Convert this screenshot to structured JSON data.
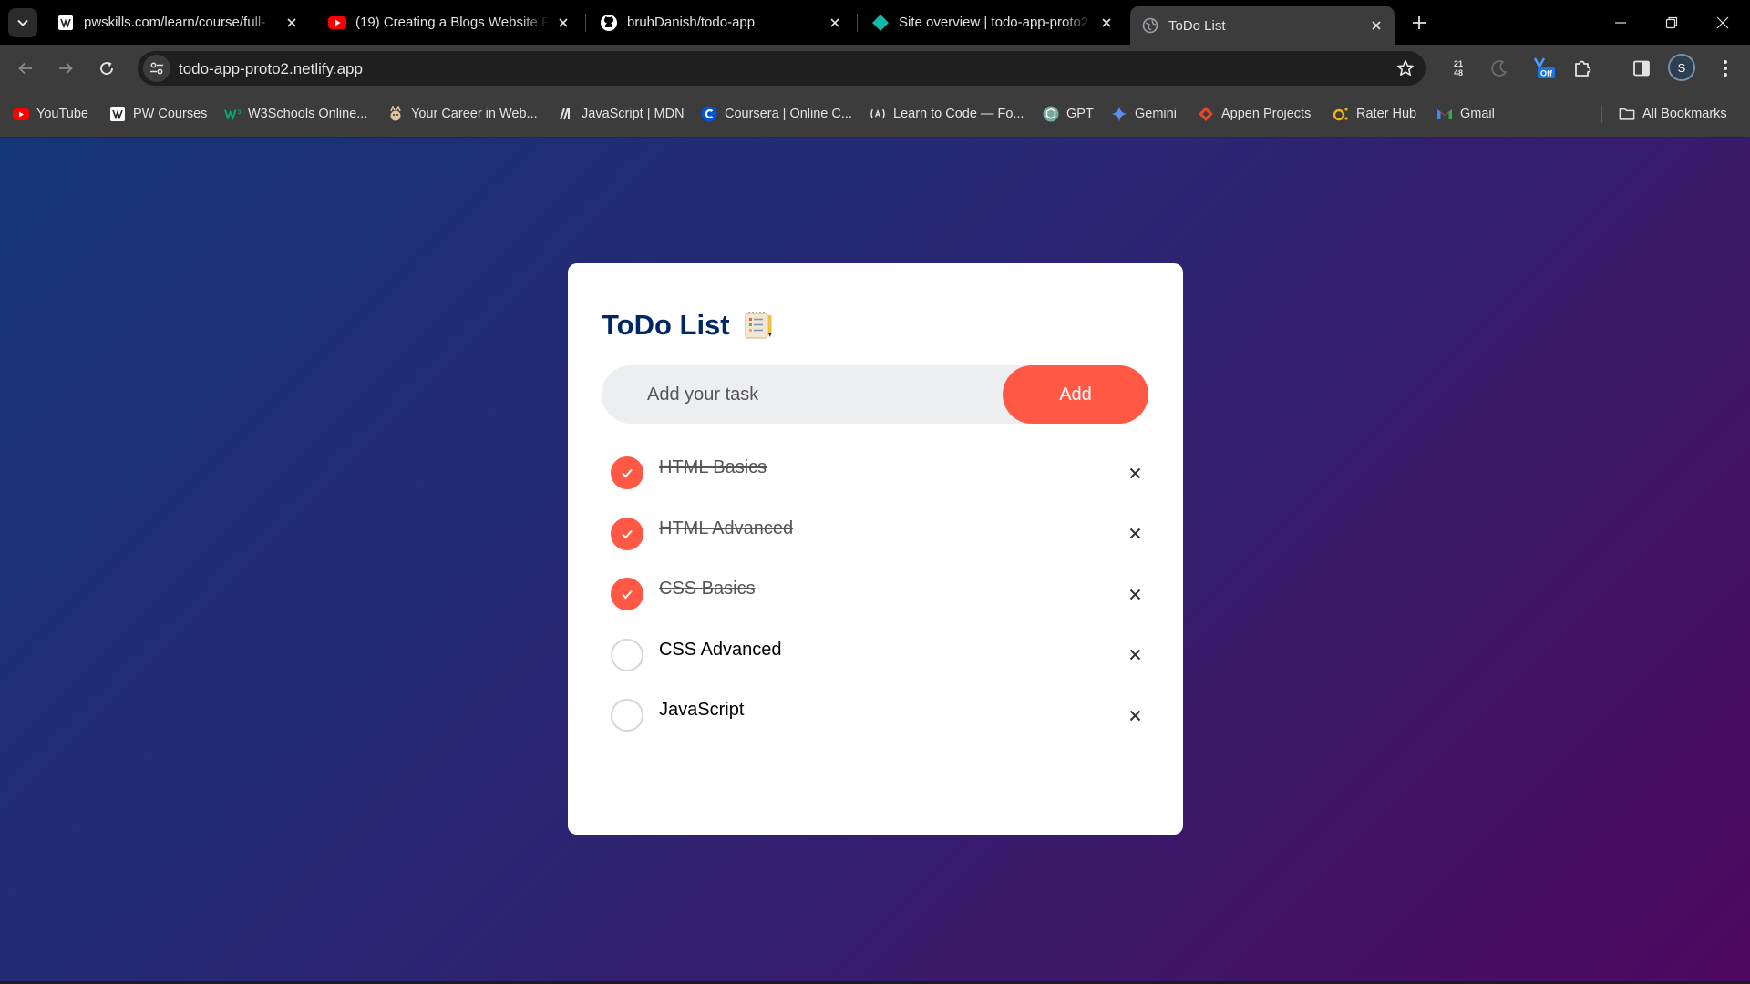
{
  "browser": {
    "tabs": [
      {
        "title": "pwskills.com/learn/course/full-",
        "icon": "pwskills-favicon"
      },
      {
        "title": "(19) Creating a Blogs Website Pr",
        "icon": "youtube-favicon"
      },
      {
        "title": "bruhDanish/todo-app",
        "icon": "github-favicon"
      },
      {
        "title": "Site overview | todo-app-proto2",
        "icon": "netlify-favicon"
      },
      {
        "title": "ToDo List",
        "icon": "globe-favicon",
        "active": true
      }
    ],
    "url": "todo-app-proto2.netlify.app",
    "ext_clock": "21\n48",
    "ext_badge": "Off",
    "profile_initial": "S",
    "bookmarks": [
      {
        "label": "YouTube",
        "icon": "youtube-icon"
      },
      {
        "label": "PW Courses",
        "icon": "pw-icon"
      },
      {
        "label": "W3Schools Online...",
        "icon": "w3schools-icon"
      },
      {
        "label": "Your Career in Web...",
        "icon": "career-icon"
      },
      {
        "label": "JavaScript | MDN",
        "icon": "mdn-icon"
      },
      {
        "label": "Coursera | Online C...",
        "icon": "coursera-icon"
      },
      {
        "label": "Learn to Code — Fo...",
        "icon": "freecodecamp-icon"
      },
      {
        "label": "GPT",
        "icon": "openai-icon"
      },
      {
        "label": "Gemini",
        "icon": "gemini-icon"
      },
      {
        "label": "Appen Projects",
        "icon": "appen-icon"
      },
      {
        "label": "Rater Hub",
        "icon": "raterhub-icon"
      },
      {
        "label": "Gmail",
        "icon": "gmail-icon"
      }
    ],
    "all_bookmarks": "All Bookmarks"
  },
  "app": {
    "title": "ToDo List",
    "input_placeholder": "Add your task",
    "add_label": "Add",
    "accent": "#ff5945",
    "title_color": "#002765",
    "tasks": [
      {
        "text": "HTML Basics",
        "done": true
      },
      {
        "text": "HTML Advanced",
        "done": true
      },
      {
        "text": "CSS Basics",
        "done": true
      },
      {
        "text": "CSS Advanced",
        "done": false
      },
      {
        "text": "JavaScript",
        "done": false
      }
    ],
    "delete_symbol": "×"
  }
}
